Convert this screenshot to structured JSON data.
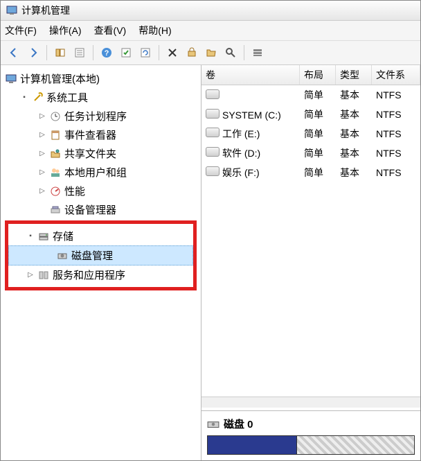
{
  "title": "计算机管理",
  "menu": {
    "file": "文件(F)",
    "action": "操作(A)",
    "view": "查看(V)",
    "help": "帮助(H)"
  },
  "tree": {
    "root": "计算机管理(本地)",
    "system_tools": "系统工具",
    "task_scheduler": "任务计划程序",
    "event_viewer": "事件查看器",
    "shared_folders": "共享文件夹",
    "local_users": "本地用户和组",
    "performance": "性能",
    "device_manager": "设备管理器",
    "storage": "存储",
    "disk_management": "磁盘管理",
    "services_apps": "服务和应用程序"
  },
  "columns": {
    "volume": "卷",
    "layout": "布局",
    "type": "类型",
    "filesystem": "文件系"
  },
  "volumes": [
    {
      "name": "",
      "layout": "简单",
      "type": "基本",
      "fs": "NTFS"
    },
    {
      "name": "SYSTEM (C:)",
      "layout": "简单",
      "type": "基本",
      "fs": "NTFS"
    },
    {
      "name": "工作 (E:)",
      "layout": "简单",
      "type": "基本",
      "fs": "NTFS"
    },
    {
      "name": "软件 (D:)",
      "layout": "简单",
      "type": "基本",
      "fs": "NTFS"
    },
    {
      "name": "娱乐 (F:)",
      "layout": "简单",
      "type": "基本",
      "fs": "NTFS"
    }
  ],
  "disk": {
    "label": "磁盘 0"
  }
}
